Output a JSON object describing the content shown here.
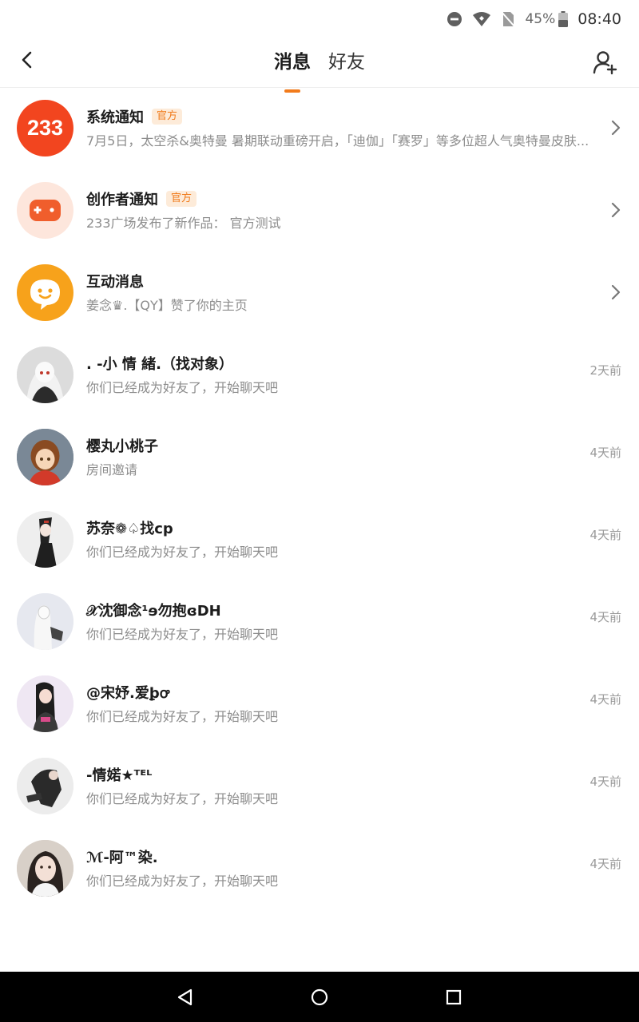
{
  "status": {
    "battery_pct": "45%",
    "time": "08:40",
    "icons": [
      "do-not-disturb-icon",
      "wifi-icon",
      "no-sim-icon",
      "battery-icon"
    ]
  },
  "header": {
    "tabs": [
      {
        "label": "消息",
        "active": true
      },
      {
        "label": "好友",
        "active": false
      }
    ],
    "icons": [
      "back-arrow-icon",
      "add-friend-icon"
    ],
    "accent": "#f27b1b"
  },
  "messages": [
    {
      "title": "系统通知",
      "badge": "官方",
      "subtitle": "7月5日，太空杀&奥特曼 暑期联动重磅开启，「迪伽」「赛罗」等多位超人气奥特曼皮肤...",
      "trailing": "chevron",
      "avatar": "233-logo"
    },
    {
      "title": "创作者通知",
      "badge": "官方",
      "subtitle": "233广场发布了新作品：  官方测试",
      "trailing": "chevron",
      "avatar": "gamepad-icon"
    },
    {
      "title": "互动消息",
      "badge": "",
      "subtitle": "姜念♛.【QY】赞了你的主页",
      "trailing": "chevron",
      "avatar": "chat-face-icon"
    },
    {
      "title": ". -小 情 緒.（找对象）",
      "subtitle": "你们已经成为好友了，开始聊天吧",
      "time": "2天前",
      "avatar": "user-avatar"
    },
    {
      "title": "樱丸小桃子",
      "subtitle": "房间邀请",
      "time": "4天前",
      "avatar": "user-avatar"
    },
    {
      "title": "苏奈❁♤找cp",
      "subtitle": "你们已经成为好友了，开始聊天吧",
      "time": "4天前",
      "avatar": "user-avatar"
    },
    {
      "title": "𝒳沈御念¹ɘ勿抱ɞDH",
      "subtitle": "你们已经成为好友了，开始聊天吧",
      "time": "4天前",
      "avatar": "user-avatar"
    },
    {
      "title": "@宋妤.爱ꝧꝍ",
      "subtitle": "你们已经成为好友了，开始聊天吧",
      "time": "4天前",
      "avatar": "user-avatar"
    },
    {
      "title": "-情婼★ᵀᴱᴸ",
      "subtitle": "你们已经成为好友了，开始聊天吧",
      "time": "4天前",
      "avatar": "user-avatar"
    },
    {
      "title": "ℳ-阿™染.",
      "subtitle": "你们已经成为好友了，开始聊天吧",
      "time": "4天前",
      "avatar": "user-avatar"
    }
  ],
  "navbar": {
    "icons": [
      "nav-back-icon",
      "nav-home-icon",
      "nav-recents-icon"
    ]
  }
}
